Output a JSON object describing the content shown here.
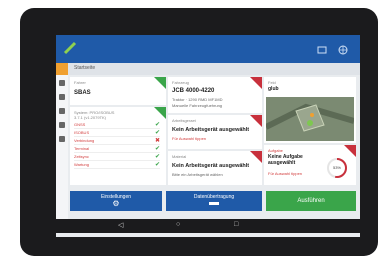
{
  "header": {
    "crumb": "Startseite"
  },
  "cards": {
    "driver": {
      "label": "Fahrer",
      "value": "SBAS"
    },
    "vehicle": {
      "label": "Fahrzeug",
      "value": "JCB 4000-4220",
      "line1": "Traktor · 1290 RMD MF1MD",
      "line2": "Manuelle Fahrzeugfuehrung"
    },
    "system": {
      "label": "System: PRO/ISOBUS",
      "version": "3.7.1 (v1.2079TK)",
      "rows": [
        {
          "name": "GNSS",
          "status": "✔",
          "status_color": "#3aa54a"
        },
        {
          "name": "ISOBUS",
          "status": "✔",
          "status_color": "#3aa54a"
        },
        {
          "name": "Verbindung",
          "status": "✖",
          "status_color": "#d23c3c"
        },
        {
          "name": "Terminal",
          "status": "✔",
          "status_color": "#3aa54a"
        },
        {
          "name": "Zeitsync",
          "status": "✔",
          "status_color": "#3aa54a"
        },
        {
          "name": "Wartung",
          "status": "✔",
          "status_color": "#3aa54a"
        }
      ]
    },
    "implement": {
      "label": "Arbeitsgeraet",
      "value": "Kein Arbeitsgerät ausgewählt",
      "note": "Für Auswahl tippen"
    },
    "material": {
      "label": "Material",
      "value": "Kein Arbeitsgerät ausgewählt",
      "note": "Bitte ein Arbeitsgerät wählen"
    },
    "field": {
      "label": "Feld",
      "value": "glub"
    },
    "task": {
      "label": "Aufgabe",
      "value": "Keine Aufgabe ausgewählt",
      "note": "Für Auswahl tippen",
      "percent": "53%"
    }
  },
  "actions": {
    "settings": "Einstellungen",
    "middle": "Datenübertragung",
    "execute": "Ausführen"
  },
  "colors": {
    "primary": "#1f5aa8",
    "success": "#3aa54a",
    "danger": "#c8303c",
    "warning": "#f0a030"
  },
  "icons": [
    "app-logo-icon",
    "share-icon",
    "globe-icon",
    "home-icon",
    "gear-icon",
    "back-icon",
    "home-nav-icon",
    "recent-apps-icon"
  ]
}
